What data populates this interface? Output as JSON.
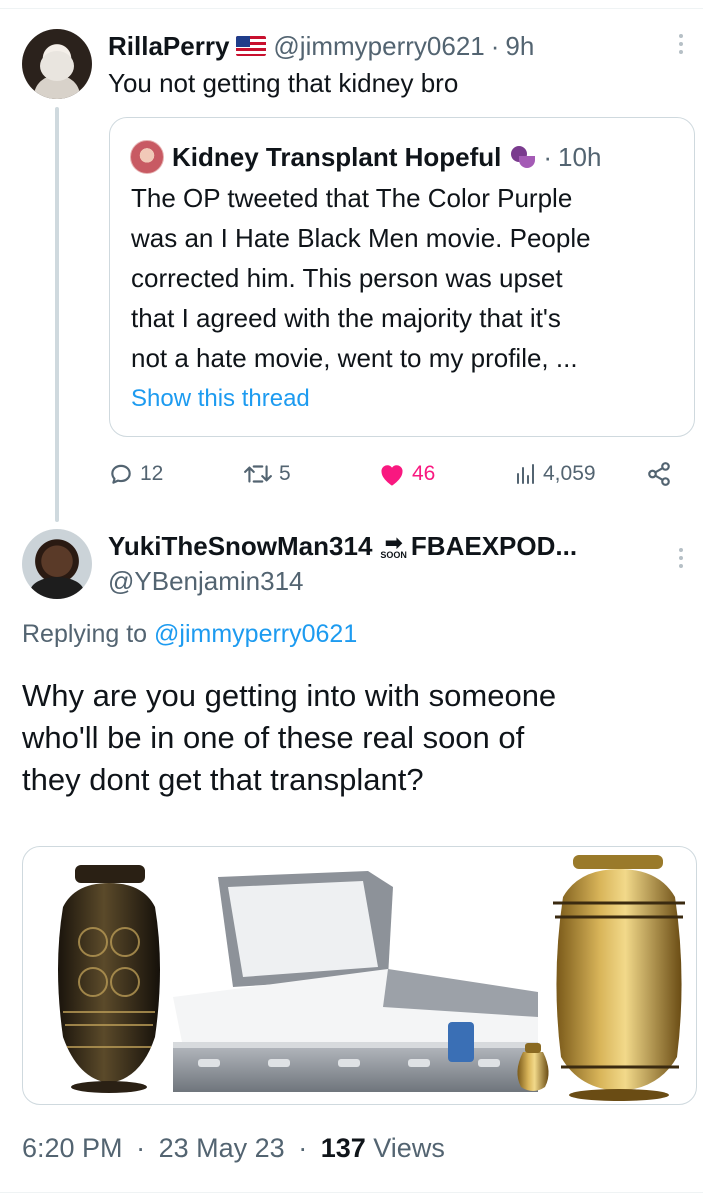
{
  "tweet1": {
    "display_name": "RillaPerry",
    "flag_icon": "us-flag-icon",
    "handle": "@jimmyperry0621",
    "time": "9h",
    "text": "You not getting that kidney bro",
    "quote": {
      "display_name": "Kidney Transplant Hopeful",
      "emoji_icon": "mermaid-emoji-icon",
      "time": "10h",
      "lines": [
        "The OP tweeted that The Color Purple",
        "was an I Hate Black Men movie. People",
        "corrected him. This person was upset",
        "that I agreed with the majority that it's",
        "not a hate movie, went to my profile, ..."
      ],
      "show_thread": "Show this thread"
    },
    "actions": {
      "replies": "12",
      "retweets": "5",
      "likes": "46",
      "views": "4,059"
    },
    "colors": {
      "like": "#f91880",
      "link": "#1d9bf0",
      "muted": "#536471"
    }
  },
  "tweet2": {
    "display_name": "YukiTheSnowMan314",
    "badge_label": "SOON",
    "badge_icon": "soon-arrow-icon",
    "display_name_suffix": "FBAEXPOD...",
    "handle": "@YBenjamin314",
    "replying_prefix": "Replying to",
    "replying_to": "@jimmyperry0621",
    "lines": [
      "Why are you getting into with someone",
      "who'll be in one of these real soon of",
      "they dont get that transplant?"
    ],
    "media_description_icon": "urns-and-casket-image",
    "footer": {
      "time": "6:20 PM",
      "date": "23 May 23",
      "views_count": "137",
      "views_label": "Views"
    }
  }
}
